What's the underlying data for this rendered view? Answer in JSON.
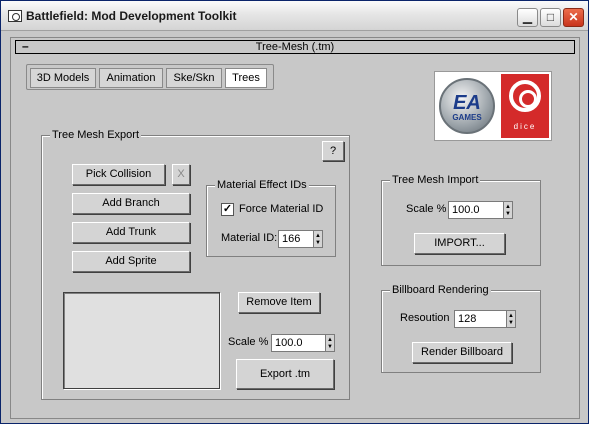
{
  "window": {
    "title": "Battlefield: Mod Development Toolkit",
    "min_glyph": "▁",
    "max_glyph": "□",
    "close_glyph": "✕"
  },
  "rollout": {
    "toggle": "–",
    "title": "Tree-Mesh (.tm)"
  },
  "tabs": [
    {
      "label": "3D Models",
      "active": false
    },
    {
      "label": "Animation",
      "active": false
    },
    {
      "label": "Ske/Skn",
      "active": false
    },
    {
      "label": "Trees",
      "active": true
    }
  ],
  "logos": {
    "ea_text": "EA",
    "ea_sub": "GAMES",
    "dice_text": "dice"
  },
  "export": {
    "group_label": "Tree Mesh Export",
    "help_label": "?",
    "pick_collision": "Pick Collision",
    "clear_label": "X",
    "add_branch": "Add Branch",
    "add_trunk": "Add Trunk",
    "add_sprite": "Add Sprite",
    "remove_item": "Remove Item",
    "scale_label": "Scale %",
    "scale_value": "100.0",
    "export_button": "Export .tm"
  },
  "material": {
    "group_label": "Material Effect IDs",
    "force_label": "Force Material ID",
    "force_checked_glyph": "✓",
    "id_label": "Material ID:",
    "id_value": "166"
  },
  "import": {
    "group_label": "Tree Mesh Import",
    "scale_label": "Scale %",
    "scale_value": "100.0",
    "import_button": "IMPORT..."
  },
  "billboard": {
    "group_label": "Billboard Rendering",
    "resolution_label": "Resoution",
    "resolution_value": "128",
    "render_button": "Render Billboard"
  },
  "colors": {
    "window_bg": "#c8c8c8",
    "dice_red": "#d42a2a",
    "ea_blue": "#1c3c8a",
    "close_red": "#c8341c"
  }
}
